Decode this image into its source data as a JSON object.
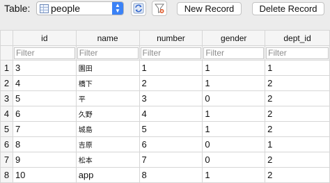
{
  "toolbar": {
    "table_label": "Table:",
    "table_select": {
      "value": "people",
      "icon": "table-icon"
    },
    "refresh_icon": "refresh-icon",
    "filter_clear_icon": "clear-filter-icon",
    "new_record_label": "New Record",
    "delete_record_label": "Delete Record"
  },
  "grid": {
    "columns": [
      "id",
      "name",
      "number",
      "gender",
      "dept_id"
    ],
    "filter_placeholder": "Filter",
    "rows": [
      {
        "n": "1",
        "cells": [
          "3",
          "園田",
          "1",
          "1",
          "1"
        ]
      },
      {
        "n": "2",
        "cells": [
          "4",
          "橋下",
          "2",
          "1",
          "2"
        ]
      },
      {
        "n": "3",
        "cells": [
          "5",
          "平",
          "3",
          "0",
          "2"
        ]
      },
      {
        "n": "4",
        "cells": [
          "6",
          "久野",
          "4",
          "1",
          "2"
        ]
      },
      {
        "n": "5",
        "cells": [
          "7",
          "城島",
          "5",
          "1",
          "2"
        ]
      },
      {
        "n": "6",
        "cells": [
          "8",
          "吉原",
          "6",
          "0",
          "1"
        ]
      },
      {
        "n": "7",
        "cells": [
          "9",
          "松本",
          "7",
          "0",
          "2"
        ]
      },
      {
        "n": "8",
        "cells": [
          "10",
          "app",
          "8",
          "1",
          "2"
        ]
      }
    ]
  },
  "colors": {
    "select_accent": "#3b82f6",
    "grid_border": "#d6d6d6",
    "header_bg": "#f5f5f5"
  }
}
